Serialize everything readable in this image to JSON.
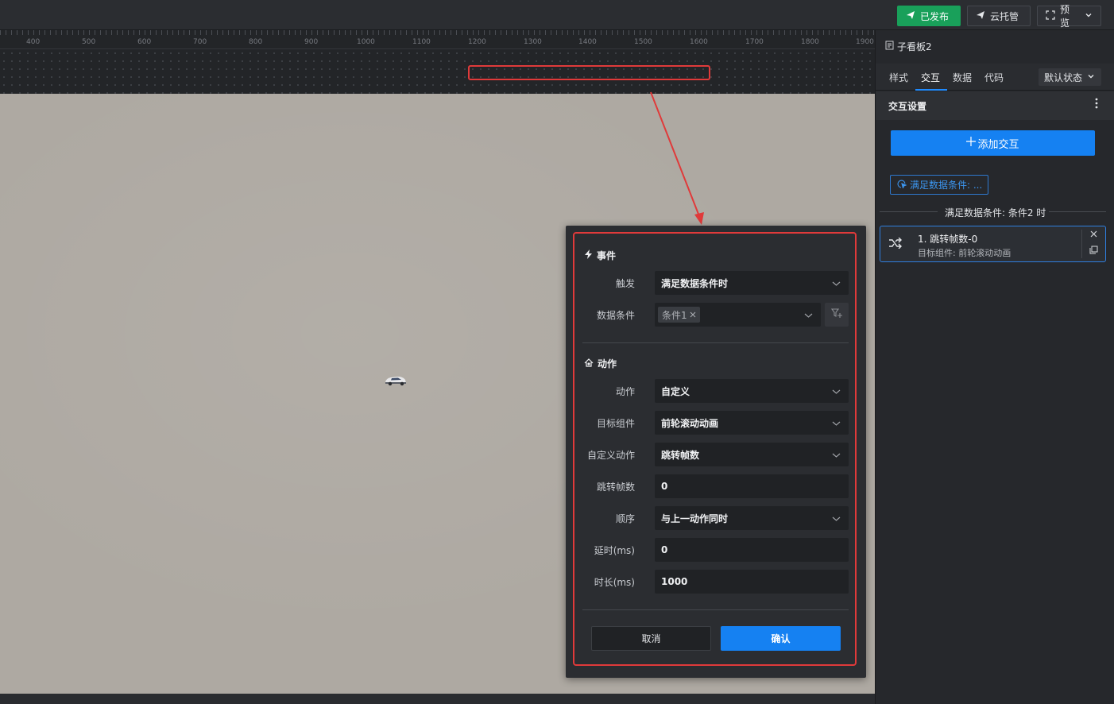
{
  "topbar": {
    "publish_label": "已发布",
    "cloud_label": "云托管",
    "preview_label": "预览"
  },
  "ruler": {
    "ticks": [
      "400",
      "500",
      "600",
      "700",
      "800",
      "900",
      "1000",
      "1100",
      "1200",
      "1300",
      "1400",
      "1500",
      "1600",
      "1700",
      "1800",
      "1900"
    ]
  },
  "panel": {
    "title": "子看板2",
    "tabs": [
      "样式",
      "交互",
      "数据",
      "代码"
    ],
    "active_tab": "交互",
    "state_select": "默认状态",
    "section_title": "交互设置",
    "add_button": "添加交互",
    "condition_chip": "满足数据条件: ...",
    "divider_text": "满足数据条件: 条件2 时",
    "action_card": {
      "title": "1. 跳转帧数-0",
      "subtitle": "目标组件: 前轮滚动动画"
    }
  },
  "dialog": {
    "event_section": "事件",
    "action_section": "动作",
    "fields": {
      "trigger": {
        "label": "触发",
        "value": "满足数据条件时"
      },
      "data_condition": {
        "label": "数据条件",
        "tag": "条件1"
      },
      "action": {
        "label": "动作",
        "value": "自定义"
      },
      "target": {
        "label": "目标组件",
        "value": "前轮滚动动画"
      },
      "custom_action": {
        "label": "自定义动作",
        "value": "跳转帧数"
      },
      "jump_frame": {
        "label": "跳转帧数",
        "value": "0"
      },
      "order": {
        "label": "顺序",
        "value": "与上一动作同时"
      },
      "delay": {
        "label": "延时(ms)",
        "value": "0"
      },
      "duration": {
        "label": "时长(ms)",
        "value": "1000"
      }
    },
    "cancel_label": "取消",
    "confirm_label": "确认"
  },
  "colors": {
    "accent_blue": "#1581f2",
    "publish_green": "#19a05a",
    "highlight_red": "#e03a3a"
  }
}
